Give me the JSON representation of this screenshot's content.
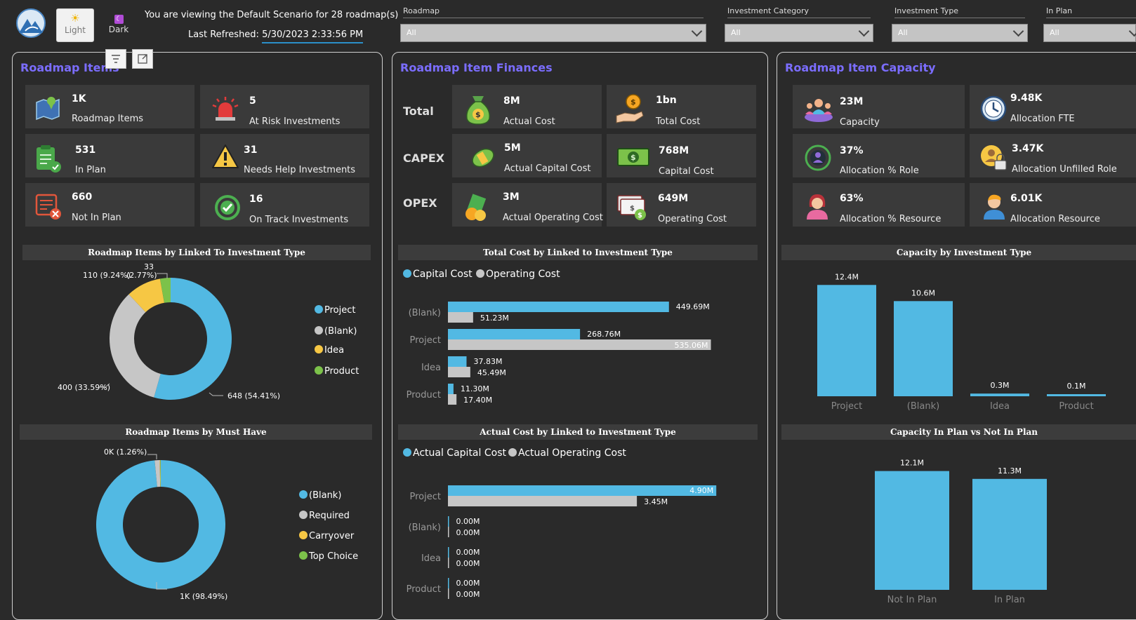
{
  "header": {
    "theme_light_label": "Light",
    "theme_dark_label": "Dark",
    "viewing_text": "You are viewing the Default Scenario for 28 roadmap(s)",
    "refresh_prefix": "Last Refreshed:",
    "refresh_time": "5/30/2023 2:33:56 PM"
  },
  "filters": [
    {
      "label": "Roadmap",
      "value": "All"
    },
    {
      "label": "Investment Category",
      "value": "All"
    },
    {
      "label": "Investment Type",
      "value": "All"
    },
    {
      "label": "In Plan",
      "value": "All"
    }
  ],
  "colors": {
    "blue": "#52b9e3",
    "gray": "#c6c6c6",
    "yellow": "#f6c744",
    "green": "#7cc24a",
    "accent": "#7b6dff"
  },
  "roadmap_items": {
    "title": "Roadmap Items",
    "cards": [
      {
        "value": "1K",
        "label": "Roadmap Items",
        "icon": "map-pin-icon"
      },
      {
        "value": "5",
        "label": "At Risk Investments",
        "icon": "alarm-siren-icon"
      },
      {
        "value": "531",
        "label": "In Plan",
        "icon": "clipboard-check-icon"
      },
      {
        "value": "31",
        "label": "Needs Help Investments",
        "icon": "warning-triangle-icon"
      },
      {
        "value": "660",
        "label": "Not In Plan",
        "icon": "list-cancel-icon"
      },
      {
        "value": "16",
        "label": "On Track Investments",
        "icon": "check-circle-icon"
      }
    ],
    "donut1": {
      "title": "Roadmap Items by Linked To Investment Type",
      "legend": [
        "Project",
        "(Blank)",
        "Idea",
        "Product"
      ],
      "labels": {
        "project": "648 (54.41%)",
        "blank": "400 (33.59%)",
        "idea": "110 (9.24%)",
        "product_count": "33",
        "product_pct": "(2.77%)"
      }
    },
    "donut2": {
      "title": "Roadmap Items by Must Have",
      "legend": [
        "(Blank)",
        "Required",
        "Carryover",
        "Top Choice"
      ],
      "labels": {
        "blank": "1K (98.49%)",
        "required": "0K (1.26%)"
      }
    }
  },
  "finances": {
    "title": "Roadmap Item Finances",
    "row_labels": [
      "Total",
      "CAPEX",
      "OPEX"
    ],
    "cards": [
      {
        "value": "8M",
        "label": "Actual Cost",
        "icon": "money-bag-icon"
      },
      {
        "value": "1bn",
        "label": "Total Cost",
        "icon": "coin-hand-icon"
      },
      {
        "value": "5M",
        "label": "Actual Capital Cost",
        "icon": "money-roll-icon"
      },
      {
        "value": "768M",
        "label": "Capital Cost",
        "icon": "dollar-bill-icon"
      },
      {
        "value": "3M",
        "label": "Actual Operating Cost",
        "icon": "cash-stack-icon"
      },
      {
        "value": "649M",
        "label": "Operating Cost",
        "icon": "bills-coin-icon"
      }
    ],
    "bar1": {
      "title": "Total Cost by Linked to Investment Type",
      "legend": [
        "Capital Cost",
        "Operating Cost"
      ],
      "categories": [
        "(Blank)",
        "Project",
        "Idea",
        "Product"
      ],
      "labels_a": [
        "449.69M",
        "268.76M",
        "37.83M",
        "11.30M"
      ],
      "labels_b": [
        "51.23M",
        "535.06M",
        "45.49M",
        "17.40M"
      ]
    },
    "bar2": {
      "title": "Actual Cost by Linked to Investment Type",
      "legend": [
        "Actual Capital Cost",
        "Actual Operating Cost"
      ],
      "categories": [
        "Project",
        "(Blank)",
        "Idea",
        "Product"
      ],
      "labels_a": [
        "4.90M",
        "0.00M",
        "0.00M",
        "0.00M"
      ],
      "labels_b": [
        "3.45M",
        "0.00M",
        "0.00M",
        "0.00M"
      ]
    }
  },
  "capacity": {
    "title": "Roadmap Item Capacity",
    "cards": [
      {
        "value": "23M",
        "label": "Capacity",
        "icon": "people-capacity-icon"
      },
      {
        "value": "9.48K",
        "label": "Allocation FTE",
        "icon": "clock-icon"
      },
      {
        "value": "37%",
        "label": "Allocation % Role",
        "icon": "target-person-icon"
      },
      {
        "value": "3.47K",
        "label": "Allocation Unfilled Role",
        "icon": "lock-person-icon"
      },
      {
        "value": "63%",
        "label": "Allocation % Resource",
        "icon": "woman-avatar-icon"
      },
      {
        "value": "6.01K",
        "label": "Allocation Resource",
        "icon": "man-avatar-icon"
      }
    ],
    "col1": {
      "title": "Capacity by Investment Type",
      "categories": [
        "Project",
        "(Blank)",
        "Idea",
        "Product"
      ],
      "labels": [
        "12.4M",
        "10.6M",
        "0.3M",
        "0.1M"
      ]
    },
    "col2": {
      "title": "Capacity In Plan vs Not In Plan",
      "categories": [
        "Not In Plan",
        "In Plan"
      ],
      "labels": [
        "12.1M",
        "11.3M"
      ]
    }
  },
  "chart_data": [
    {
      "type": "pie",
      "title": "Roadmap Items by Linked To Investment Type",
      "categories": [
        "Project",
        "(Blank)",
        "Idea",
        "Product"
      ],
      "values": [
        648,
        400,
        110,
        33
      ],
      "percent": [
        54.41,
        33.59,
        9.24,
        2.77
      ],
      "legend": "right"
    },
    {
      "type": "pie",
      "title": "Roadmap Items by Must Have",
      "categories": [
        "(Blank)",
        "Required",
        "Carryover",
        "Top Choice"
      ],
      "values": [
        98.49,
        1.26,
        0.13,
        0.12
      ],
      "legend": "right"
    },
    {
      "type": "bar",
      "title": "Total Cost by Linked to Investment Type",
      "categories": [
        "(Blank)",
        "Project",
        "Idea",
        "Product"
      ],
      "series": [
        {
          "name": "Capital Cost",
          "values": [
            449.69,
            268.76,
            37.83,
            11.3
          ]
        },
        {
          "name": "Operating Cost",
          "values": [
            51.23,
            535.06,
            45.49,
            17.4
          ]
        }
      ],
      "unit": "M",
      "orientation": "horizontal",
      "legend": "top-left"
    },
    {
      "type": "bar",
      "title": "Actual Cost by Linked to Investment Type",
      "categories": [
        "Project",
        "(Blank)",
        "Idea",
        "Product"
      ],
      "series": [
        {
          "name": "Actual Capital Cost",
          "values": [
            4.9,
            0.0,
            0.0,
            0.0
          ]
        },
        {
          "name": "Actual Operating Cost",
          "values": [
            3.45,
            0.0,
            0.0,
            0.0
          ]
        }
      ],
      "unit": "M",
      "orientation": "horizontal",
      "legend": "top-left"
    },
    {
      "type": "bar",
      "title": "Capacity by Investment Type",
      "categories": [
        "Project",
        "(Blank)",
        "Idea",
        "Product"
      ],
      "values": [
        12.4,
        10.6,
        0.3,
        0.1
      ],
      "unit": "M"
    },
    {
      "type": "bar",
      "title": "Capacity In Plan vs Not In Plan",
      "categories": [
        "Not In Plan",
        "In Plan"
      ],
      "values": [
        12.1,
        11.3
      ],
      "unit": "M"
    }
  ]
}
